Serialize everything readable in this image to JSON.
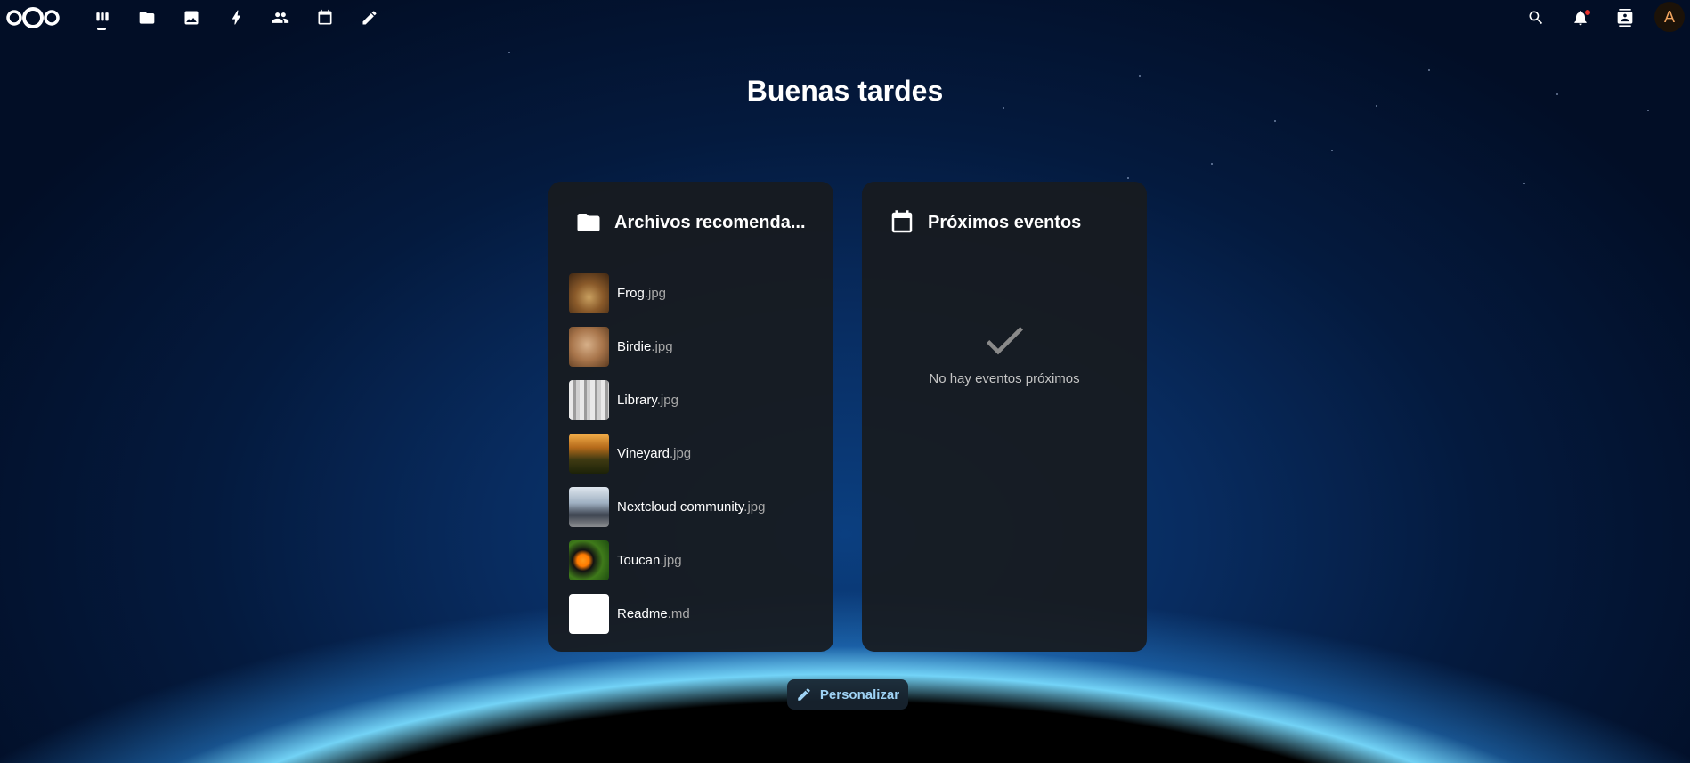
{
  "topbar": {
    "apps": [
      {
        "name": "dashboard",
        "icon": "dashboard-icon"
      },
      {
        "name": "files",
        "icon": "folder-icon"
      },
      {
        "name": "photos",
        "icon": "image-icon"
      },
      {
        "name": "activity",
        "icon": "lightning-icon"
      },
      {
        "name": "contacts",
        "icon": "users-icon"
      },
      {
        "name": "calendar",
        "icon": "calendar-icon"
      },
      {
        "name": "notes",
        "icon": "pencil-icon"
      }
    ],
    "avatar_initial": "A"
  },
  "greeting": "Buenas tardes",
  "widgets": {
    "files": {
      "title": "Archivos recomenda...",
      "icon": "folder-icon",
      "items": [
        {
          "name": "Frog",
          "ext": ".jpg"
        },
        {
          "name": "Birdie",
          "ext": ".jpg"
        },
        {
          "name": "Library",
          "ext": ".jpg"
        },
        {
          "name": "Vineyard",
          "ext": ".jpg"
        },
        {
          "name": "Nextcloud community",
          "ext": ".jpg"
        },
        {
          "name": "Toucan",
          "ext": ".jpg"
        },
        {
          "name": "Readme",
          "ext": ".md"
        }
      ]
    },
    "events": {
      "title": "Próximos eventos",
      "icon": "calendar-icon",
      "empty_text": "No hay eventos próximos"
    }
  },
  "customize_label": "Personalizar",
  "colors": {
    "accent_button_text": "#9fd3f5",
    "notification_dot": "#e9322d",
    "avatar_text": "#f0a35e"
  }
}
